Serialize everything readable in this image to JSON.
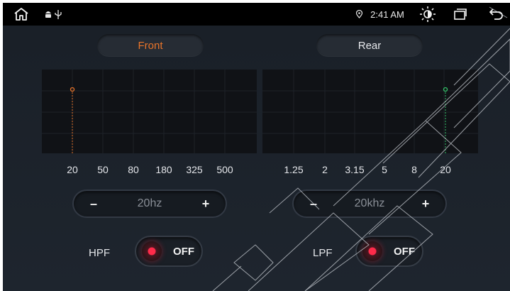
{
  "status_bar": {
    "time": "2:41 AM",
    "icons": [
      "home-icon",
      "android-icon",
      "usb-icon",
      "location-icon",
      "brightness-icon",
      "recent-apps-icon",
      "back-icon"
    ]
  },
  "tabs": [
    {
      "label": "Front",
      "active": true,
      "color": "#e8742a"
    },
    {
      "label": "Rear",
      "active": false,
      "color": "#e6e8ec"
    }
  ],
  "front": {
    "ticks": [
      "20",
      "50",
      "80",
      "180",
      "325",
      "500"
    ],
    "marker_tick": "20",
    "marker_color": "#e8742a",
    "stepper": {
      "minus": "–",
      "value": "20hz",
      "plus": "+"
    },
    "filter_label": "HPF",
    "toggle_label": "OFF",
    "toggle_on": false
  },
  "rear": {
    "ticks": [
      "1.25",
      "2",
      "3.15",
      "5",
      "8",
      "20"
    ],
    "marker_tick": "20",
    "marker_color": "#35c46a",
    "stepper": {
      "minus": "–",
      "value": "20khz",
      "plus": "+"
    },
    "filter_label": "LPF",
    "toggle_label": "OFF",
    "toggle_on": false
  },
  "colors": {
    "background": "#1b2129",
    "graph_bg": "#101216",
    "accent_front": "#e8742a",
    "accent_rear": "#35c46a",
    "toggle_dot": "#ff2b4a"
  }
}
